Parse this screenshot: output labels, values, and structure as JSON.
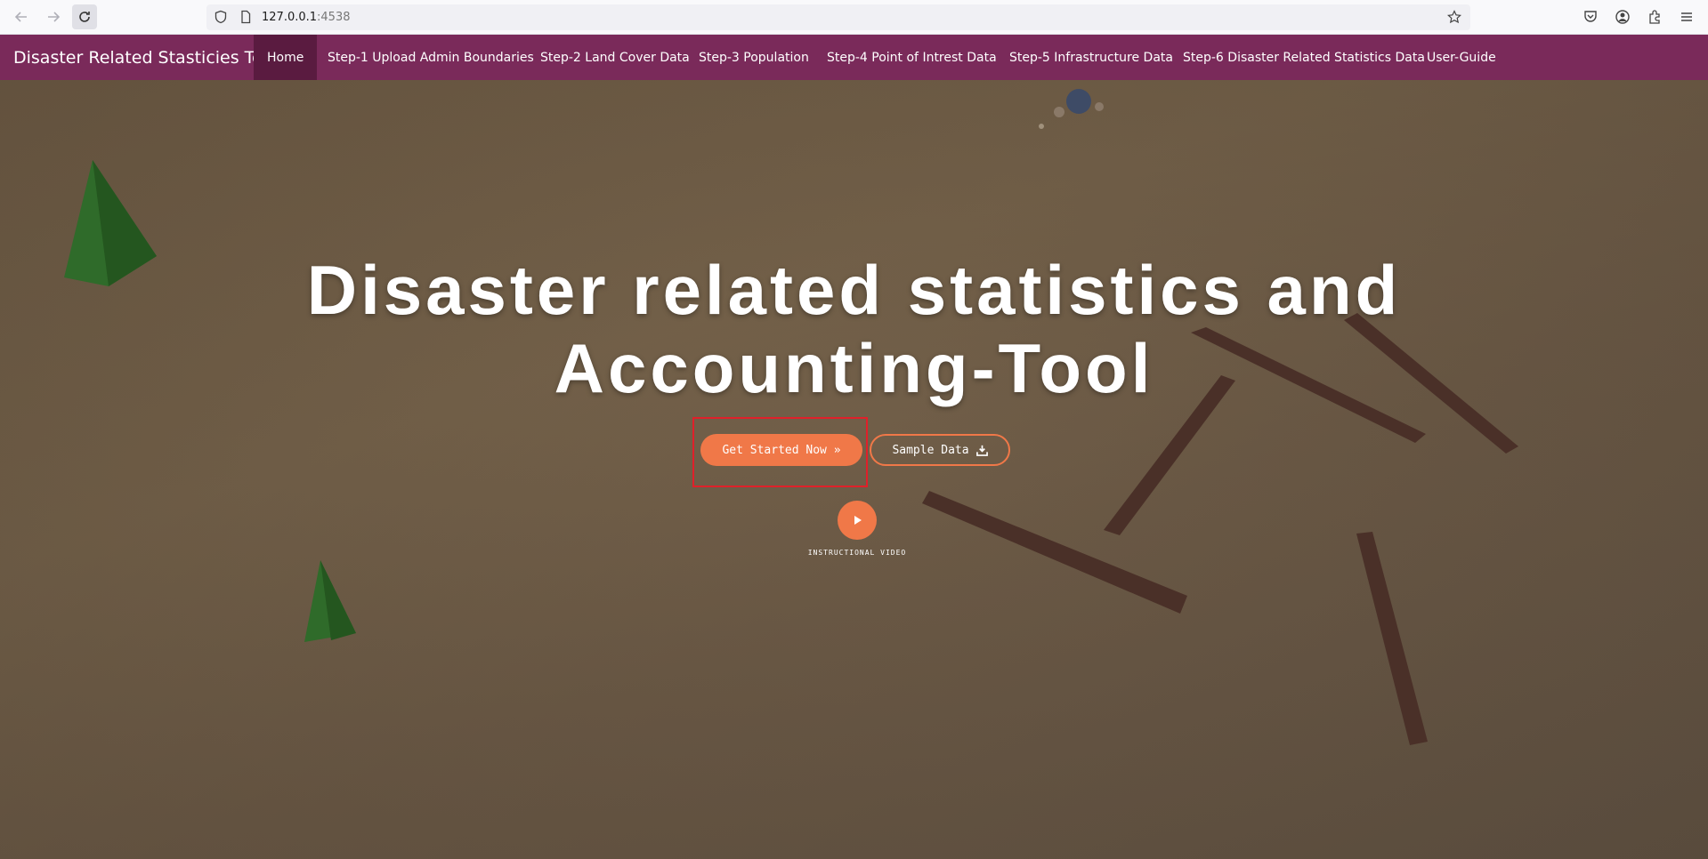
{
  "browser": {
    "url_host": "127.0.0.1",
    "url_port": ":4538",
    "icons": [
      "back-arrow-icon",
      "forward-arrow-icon",
      "reload-icon",
      "shield-icon",
      "page-icon",
      "star-icon",
      "pocket-icon",
      "account-icon",
      "extensions-icon",
      "menu-icon"
    ]
  },
  "navbar": {
    "brand": "Disaster Related Stasticies Tool",
    "items": [
      {
        "label": "Home",
        "active": true
      },
      {
        "label": "Step-1 Upload Admin Boundaries"
      },
      {
        "label": "Step-2 Land Cover Data"
      },
      {
        "label": "Step-3 Population"
      },
      {
        "label": "Step-4 Point of Intrest Data"
      },
      {
        "label": "Step-5 Infrastructure Data"
      },
      {
        "label": "Step-6 Disaster Related Statistics Data"
      },
      {
        "label": "User-Guide"
      }
    ],
    "color": "#7a2a5a",
    "active_color": "#5a1b40"
  },
  "hero": {
    "title_line1": "Disaster related statistics and",
    "title_line2": "Accounting-Tool",
    "start_button": "Get Started Now »",
    "sample_button": "Sample Data",
    "video_label": "INSTRUCTIONAL VIDEO",
    "accent_color": "#f07848",
    "highlight_color": "#e0202a"
  }
}
